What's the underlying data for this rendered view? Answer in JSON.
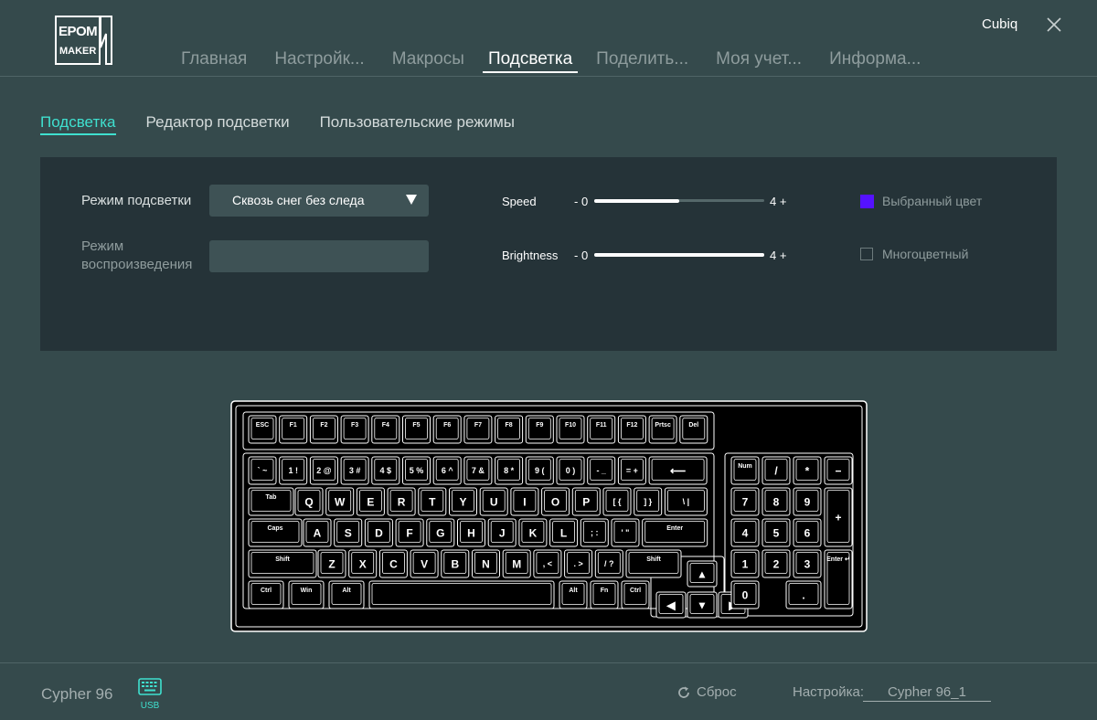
{
  "brand": {
    "logo_lines": [
      "EPOM",
      "MAKER"
    ]
  },
  "header": {
    "user": "Cubiq"
  },
  "nav": {
    "tabs": [
      {
        "label": "Главная"
      },
      {
        "label": "Настройк..."
      },
      {
        "label": "Макросы"
      },
      {
        "label": "Подсветка"
      },
      {
        "label": "Поделить..."
      },
      {
        "label": "Моя учет..."
      },
      {
        "label": "Информа..."
      }
    ],
    "active": "Подсветка"
  },
  "subtabs": {
    "items": [
      {
        "label": "Подсветка"
      },
      {
        "label": "Редактор подсветки"
      },
      {
        "label": "Пользовательские режимы"
      }
    ]
  },
  "lighting": {
    "mode_label": "Режим подсветки",
    "mode_value": "Сквозь снег без следа",
    "playback_label_1": "Режим",
    "playback_label_2": "воспроизведения",
    "playback_value": "",
    "speed": {
      "label": "Speed",
      "min_label": "- 0",
      "max_label": "4 +",
      "fraction": 0.5
    },
    "brightness": {
      "label": "Brightness",
      "min_label": "- 0",
      "max_label": "4 +",
      "fraction": 1.0
    },
    "selected_color": {
      "label": "Выбранный цвет",
      "checked": true,
      "color": "#5512ff"
    },
    "multicolor": {
      "label": "Многоцветный",
      "checked": false
    }
  },
  "keyboard": {
    "rows": [
      [
        "ESC",
        "F1",
        "F2",
        "F3",
        "F4",
        "F5",
        "F6",
        "F7",
        "F8",
        "F9",
        "F10",
        "F11",
        "F12",
        "Prtsc",
        "Del"
      ],
      [
        "` ~",
        "1 !",
        "2 @",
        "3 #",
        "4 $",
        "5 %",
        "6 ^",
        "7 &",
        "8 *",
        "9 (",
        "0 )",
        "- _",
        "= +",
        "⟵",
        "Num",
        "/",
        "*",
        "−"
      ],
      [
        "Tab",
        "Q",
        "W",
        "E",
        "R",
        "T",
        "Y",
        "U",
        "I",
        "O",
        "P",
        "[ {",
        "] }",
        "\\ |",
        "7",
        "8",
        "9",
        "+"
      ],
      [
        "Caps",
        "A",
        "S",
        "D",
        "F",
        "G",
        "H",
        "J",
        "K",
        "L",
        "; :",
        "' \"",
        "Enter",
        "4",
        "5",
        "6"
      ],
      [
        "Shift",
        "Z",
        "X",
        "C",
        "V",
        "B",
        "N",
        "M",
        ", <",
        ". >",
        "/ ?",
        "Shift",
        "▲",
        "1",
        "2",
        "3",
        "Enter ↵"
      ],
      [
        "Ctrl",
        "Win",
        "Alt",
        "",
        "Alt",
        "Fn",
        "Ctrl",
        "◀",
        "▼",
        "▶",
        "0",
        "."
      ]
    ]
  },
  "footer": {
    "device": "Cypher 96",
    "connection": "USB",
    "reset": "Сброс",
    "profile_label": "Настройка:",
    "profile_value": "Cypher 96_1"
  }
}
